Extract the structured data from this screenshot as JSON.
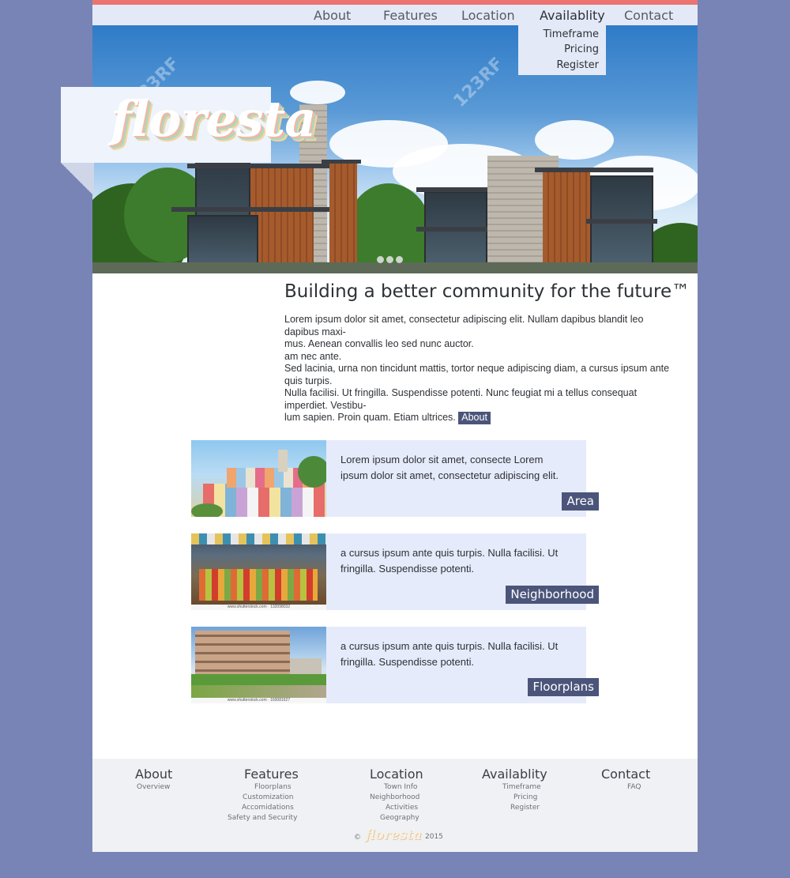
{
  "nav": {
    "items": [
      "About",
      "Features",
      "Location",
      "Availablity",
      "Contact"
    ],
    "dropdown": [
      "Timeframe",
      "Pricing",
      "Register"
    ]
  },
  "brand": {
    "logo": "floresta"
  },
  "hero": {
    "watermark": "123RF"
  },
  "intro": {
    "title": "Building a better community for the future™",
    "p1_line1": "Lorem ipsum dolor sit amet, consectetur adipiscing elit. Nullam dapibus blandit leo dapibus maxi-",
    "p1_line2": "mus. Aenean convallis leo sed nunc auctor.",
    "p1_line3": "am nec ante.",
    "p2_line1": "Sed lacinia, urna non tincidunt mattis, tortor neque adipiscing diam, a cursus ipsum ante quis turpis.",
    "p2_line2": "Nulla facilisi. Ut fringilla. Suspendisse potenti. Nunc feugiat mi a tellus consequat imperdiet. Vestibu-",
    "p2_line3": "lum sapien. Proin quam. Etiam ultrices.",
    "about_link": "About"
  },
  "cards": [
    {
      "text1": "Lorem ipsum dolor sit amet, consecte  Lorem",
      "text2": "ipsum dolor sit amet, consectetur adipiscing elit.",
      "button": "Area"
    },
    {
      "text1": "a cursus ipsum ante quis turpis. Nulla facilisi. Ut",
      "text2": "fringilla. Suspendisse potenti.",
      "button": "Neighborhood",
      "credit": "www.shutterstock.com · 132098032"
    },
    {
      "text1": "a cursus ipsum ante quis turpis. Nulla facilisi. Ut",
      "text2": "fringilla. Suspendisse potenti.",
      "button": "Floorplans",
      "credit": "www.shutterstock.com · 160081627"
    }
  ],
  "footer": {
    "about": {
      "title": "About",
      "links": [
        "Overview"
      ]
    },
    "features": {
      "title": "Features",
      "links": [
        "Floorplans",
        "Customization",
        "Accomidations",
        "Safety and Security"
      ]
    },
    "location": {
      "title": "Location",
      "links": [
        "Town Info",
        "Neighborhood",
        "Activities",
        "Geography"
      ]
    },
    "availability": {
      "title": "Availablity",
      "links": [
        "Timeframe",
        "Pricing",
        "Register"
      ]
    },
    "contact": {
      "title": "Contact",
      "links": [
        "FAQ"
      ]
    },
    "copyright_symbol": "©",
    "year": "2015"
  },
  "colors": {
    "background": "#7884b6",
    "accent_bar": "#ec7372",
    "nav_bg": "#e3e9f7",
    "card_bg": "#e6ebfb",
    "button_bg": "#4b557a",
    "footer_bg": "#f0f1f4"
  }
}
